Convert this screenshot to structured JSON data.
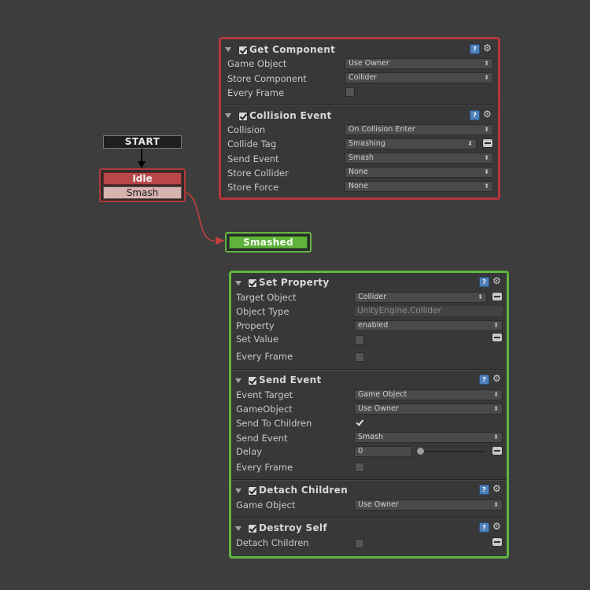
{
  "fsm": {
    "start_label": "START",
    "idle_state": {
      "title": "Idle",
      "transition": "Smash"
    },
    "smashed_state": {
      "title": "Smashed"
    },
    "colors": {
      "idle_border": "#b3383c",
      "smashed_border": "#63b540",
      "transition_link": "#c04040"
    }
  },
  "icons": {
    "help": "help-book-icon",
    "settings": "gear-icon",
    "collapse": "triangle-down-icon"
  },
  "idle_actions": {
    "get_component": {
      "title": "Get Component",
      "rows": [
        {
          "label": "Game Object",
          "value": "Use Owner"
        },
        {
          "label": "Store Component",
          "value": "Collider"
        },
        {
          "label": "Every Frame",
          "value": ""
        }
      ]
    },
    "collision_event": {
      "title": "Collision Event",
      "rows": [
        {
          "label": "Collision",
          "value": "On Collision Enter"
        },
        {
          "label": "Collide Tag",
          "value": "Smashing"
        },
        {
          "label": "Send Event",
          "value": "Smash"
        },
        {
          "label": "Store Collider",
          "value": "None"
        },
        {
          "label": "Store Force",
          "value": "None"
        }
      ]
    }
  },
  "smashed_actions": {
    "set_property": {
      "title": "Set Property",
      "rows": [
        {
          "label": "Target Object",
          "value": "Collider"
        },
        {
          "label": "Object Type",
          "value": "UnityEngine.Collider"
        },
        {
          "label": "Property",
          "value": "enabled"
        },
        {
          "label": "Set Value",
          "value": ""
        },
        {
          "label": "Every Frame",
          "value": ""
        }
      ]
    },
    "send_event": {
      "title": "Send Event",
      "rows": [
        {
          "label": "Event Target",
          "value": "Game Object"
        },
        {
          "label": "GameObject",
          "value": "Use Owner"
        },
        {
          "label": "Send To Children",
          "value": ""
        },
        {
          "label": "Send Event",
          "value": "Smash"
        },
        {
          "label": "Delay",
          "value": "0"
        },
        {
          "label": "Every Frame",
          "value": ""
        }
      ]
    },
    "detach_children": {
      "title": "Detach Children",
      "rows": [
        {
          "label": "Game Object",
          "value": "Use Owner"
        }
      ]
    },
    "destroy_self": {
      "title": "Destroy Self",
      "rows": [
        {
          "label": "Detach Children",
          "value": ""
        }
      ]
    }
  }
}
